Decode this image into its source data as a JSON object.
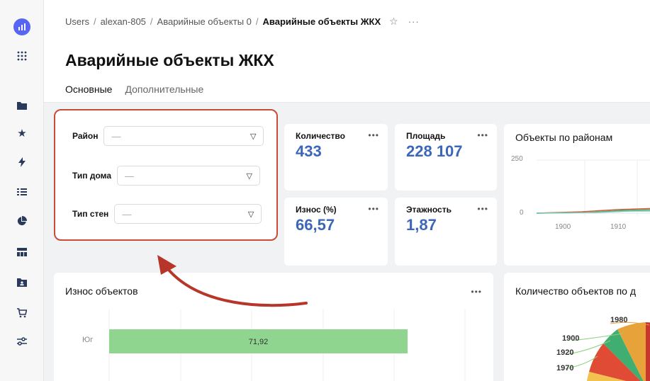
{
  "breadcrumb": {
    "items": [
      "Users",
      "alexan-805",
      "Аварийные объекты 0"
    ],
    "current": "Аварийные объекты ЖКХ",
    "star_icon": "star-outline-icon",
    "more_label": "···"
  },
  "page": {
    "title": "Аварийные объекты ЖКХ",
    "tabs": [
      {
        "label": "Основные",
        "active": true
      },
      {
        "label": "Дополнительные",
        "active": false
      }
    ]
  },
  "sidebar": {
    "icons": [
      "app-logo-icon",
      "apps-grid-icon",
      "folder-icon",
      "star-icon",
      "bolt-icon",
      "list-icon",
      "pie-chart-icon",
      "dashboard-icon",
      "folder-user-icon",
      "cart-icon",
      "settings-sliders-icon"
    ]
  },
  "filters": {
    "rows": [
      {
        "label": "Район",
        "value": "—"
      },
      {
        "label": "Тип дома",
        "value": "—"
      },
      {
        "label": "Тип стен",
        "value": "—"
      }
    ],
    "highlight_color": "#c84c36"
  },
  "kpis": [
    {
      "label": "Количество",
      "value": "433"
    },
    {
      "label": "Площадь",
      "value": "228 107"
    },
    {
      "label": "Износ (%)",
      "value": "66,57"
    },
    {
      "label": "Этажность",
      "value": "1,87"
    }
  ],
  "kpi_more": "•••",
  "accent_color": "#3c66b8",
  "chart_data": [
    {
      "type": "line",
      "title": "Объекты по районам",
      "x": [
        "1900",
        "1910"
      ],
      "y_ticks": [
        "250",
        "0"
      ],
      "ylim": [
        0,
        250
      ]
    },
    {
      "type": "bar",
      "title": "Износ объектов",
      "categories": [
        "Юг"
      ],
      "values": [
        71.92
      ],
      "value_labels": [
        "71,92"
      ],
      "bar_color": "#8fd48f"
    },
    {
      "type": "pie",
      "title": "Количество объектов по д",
      "labels": [
        "1980",
        "1900",
        "1920",
        "1970"
      ]
    }
  ],
  "bar_more": "•••"
}
